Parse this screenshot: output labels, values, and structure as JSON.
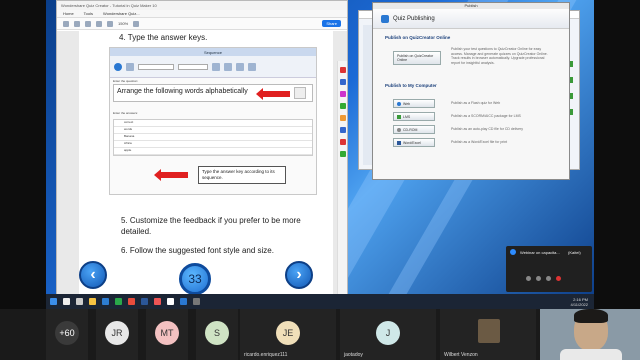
{
  "pdf_window": {
    "title": "Wondershare Quiz Creator - Tutorial in Quiz Maker 10",
    "menu": [
      "Home",
      "Tools",
      "Window",
      "Help"
    ],
    "tab": "Wondershare Quiz...",
    "zoom": "150%",
    "share_label": "Share"
  },
  "document": {
    "heading": "4. Type the answer keys.",
    "inner_titlebar": "Sequence",
    "inner_tab": "Sequence",
    "select_question_label": "Enter the question:",
    "question_text": "Arrange the following words alphabetically",
    "answers_label": "Enter the answers:",
    "answer_rows": [
      "correct",
      "words",
      "Banana",
      "Africa",
      "apple"
    ],
    "callout": "Type the answer key according to its sequence.",
    "step5": "5. Customize the feedback if you prefer to be more detailed.",
    "step6": "6. Follow the suggested font style and size.",
    "page_number": "33",
    "prev_label": "‹",
    "next_label": "›"
  },
  "dialog": {
    "title": "Publish",
    "header": "Quiz Publishing",
    "section1": "Publish on QuizCreator Online",
    "btn_online": "Publish on QuizCreator Online",
    "desc_online": "Publish your test questions to QuizCreator Online for easy access. Manage and generate quizzes on QuizCreator Online. Track results in browser automatically. Upgrade professional report for insightful analysis.",
    "section2": "Publish to My Computer",
    "btn_web": "Web",
    "desc_web": "Publish as a Flash quiz for Web",
    "btn_lms": "LMS",
    "desc_lms": "Publish as a SCORM/AICC package for LMS",
    "btn_cdrom": "CD-ROM",
    "desc_cdrom": "Publish as an auto-play CD file for CD delivery",
    "btn_word": "Word/Excel",
    "desc_word": "Publish as a Word/Excel file for print"
  },
  "taskbar": {
    "time": "2:16 PM",
    "date": "4/11/2022"
  },
  "notification": {
    "title": "Webinar on capacita...",
    "host": "(Kaitel)"
  },
  "participants": [
    {
      "initials": "+60",
      "color": "#3a3a3a",
      "name": ""
    },
    {
      "initials": "JR",
      "color": "#e8e8e8",
      "name": ""
    },
    {
      "initials": "MT",
      "color": "#f3c1c1",
      "name": ""
    },
    {
      "initials": "S",
      "color": "#cfe3c4",
      "name": ""
    },
    {
      "initials": "JE",
      "color": "#f0dfb9",
      "name": "ricardo.enriquez111"
    },
    {
      "initials": "J",
      "color": "#cfe8e8",
      "name": "jaotadoy"
    },
    {
      "initials": "",
      "color": "#6b5a44",
      "name": "Wilbert Venzon"
    },
    {
      "initials": "",
      "color": "#c8b49c",
      "name": ""
    }
  ],
  "colors": {
    "accent_blue": "#1a73e8",
    "red_arrow": "#e02020",
    "desktop": "#1c6ad6"
  }
}
